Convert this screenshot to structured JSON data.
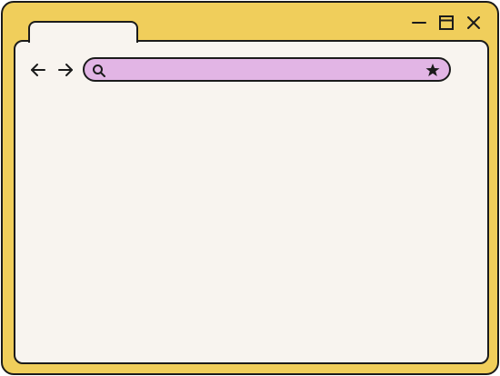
{
  "window": {
    "controls": [
      "minimize-icon",
      "maximize-icon",
      "close-icon"
    ],
    "frame_color": "#F0CE5B",
    "content_color": "#F8F4EF"
  },
  "tabs": [
    {
      "label": ""
    }
  ],
  "navigation": {
    "back_icon": "arrow-left-icon",
    "forward_icon": "arrow-right-icon"
  },
  "address_bar": {
    "value": "",
    "placeholder": "",
    "search_icon": "search-icon",
    "bookmark_icon": "star-icon",
    "color": "#E2B5E5"
  }
}
